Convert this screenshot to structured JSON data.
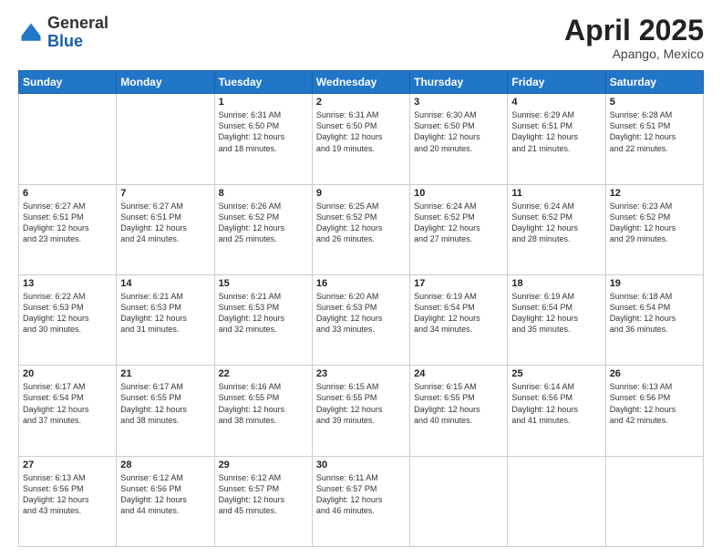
{
  "header": {
    "logo_general": "General",
    "logo_blue": "Blue",
    "month_title": "April 2025",
    "location": "Apango, Mexico"
  },
  "weekdays": [
    "Sunday",
    "Monday",
    "Tuesday",
    "Wednesday",
    "Thursday",
    "Friday",
    "Saturday"
  ],
  "weeks": [
    [
      {
        "day": "",
        "sunrise": "",
        "sunset": "",
        "daylight": ""
      },
      {
        "day": "",
        "sunrise": "",
        "sunset": "",
        "daylight": ""
      },
      {
        "day": "1",
        "sunrise": "Sunrise: 6:31 AM",
        "sunset": "Sunset: 6:50 PM",
        "daylight": "Daylight: 12 hours and 18 minutes."
      },
      {
        "day": "2",
        "sunrise": "Sunrise: 6:31 AM",
        "sunset": "Sunset: 6:50 PM",
        "daylight": "Daylight: 12 hours and 19 minutes."
      },
      {
        "day": "3",
        "sunrise": "Sunrise: 6:30 AM",
        "sunset": "Sunset: 6:50 PM",
        "daylight": "Daylight: 12 hours and 20 minutes."
      },
      {
        "day": "4",
        "sunrise": "Sunrise: 6:29 AM",
        "sunset": "Sunset: 6:51 PM",
        "daylight": "Daylight: 12 hours and 21 minutes."
      },
      {
        "day": "5",
        "sunrise": "Sunrise: 6:28 AM",
        "sunset": "Sunset: 6:51 PM",
        "daylight": "Daylight: 12 hours and 22 minutes."
      }
    ],
    [
      {
        "day": "6",
        "sunrise": "Sunrise: 6:27 AM",
        "sunset": "Sunset: 6:51 PM",
        "daylight": "Daylight: 12 hours and 23 minutes."
      },
      {
        "day": "7",
        "sunrise": "Sunrise: 6:27 AM",
        "sunset": "Sunset: 6:51 PM",
        "daylight": "Daylight: 12 hours and 24 minutes."
      },
      {
        "day": "8",
        "sunrise": "Sunrise: 6:26 AM",
        "sunset": "Sunset: 6:52 PM",
        "daylight": "Daylight: 12 hours and 25 minutes."
      },
      {
        "day": "9",
        "sunrise": "Sunrise: 6:25 AM",
        "sunset": "Sunset: 6:52 PM",
        "daylight": "Daylight: 12 hours and 26 minutes."
      },
      {
        "day": "10",
        "sunrise": "Sunrise: 6:24 AM",
        "sunset": "Sunset: 6:52 PM",
        "daylight": "Daylight: 12 hours and 27 minutes."
      },
      {
        "day": "11",
        "sunrise": "Sunrise: 6:24 AM",
        "sunset": "Sunset: 6:52 PM",
        "daylight": "Daylight: 12 hours and 28 minutes."
      },
      {
        "day": "12",
        "sunrise": "Sunrise: 6:23 AM",
        "sunset": "Sunset: 6:52 PM",
        "daylight": "Daylight: 12 hours and 29 minutes."
      }
    ],
    [
      {
        "day": "13",
        "sunrise": "Sunrise: 6:22 AM",
        "sunset": "Sunset: 6:53 PM",
        "daylight": "Daylight: 12 hours and 30 minutes."
      },
      {
        "day": "14",
        "sunrise": "Sunrise: 6:21 AM",
        "sunset": "Sunset: 6:53 PM",
        "daylight": "Daylight: 12 hours and 31 minutes."
      },
      {
        "day": "15",
        "sunrise": "Sunrise: 6:21 AM",
        "sunset": "Sunset: 6:53 PM",
        "daylight": "Daylight: 12 hours and 32 minutes."
      },
      {
        "day": "16",
        "sunrise": "Sunrise: 6:20 AM",
        "sunset": "Sunset: 6:53 PM",
        "daylight": "Daylight: 12 hours and 33 minutes."
      },
      {
        "day": "17",
        "sunrise": "Sunrise: 6:19 AM",
        "sunset": "Sunset: 6:54 PM",
        "daylight": "Daylight: 12 hours and 34 minutes."
      },
      {
        "day": "18",
        "sunrise": "Sunrise: 6:19 AM",
        "sunset": "Sunset: 6:54 PM",
        "daylight": "Daylight: 12 hours and 35 minutes."
      },
      {
        "day": "19",
        "sunrise": "Sunrise: 6:18 AM",
        "sunset": "Sunset: 6:54 PM",
        "daylight": "Daylight: 12 hours and 36 minutes."
      }
    ],
    [
      {
        "day": "20",
        "sunrise": "Sunrise: 6:17 AM",
        "sunset": "Sunset: 6:54 PM",
        "daylight": "Daylight: 12 hours and 37 minutes."
      },
      {
        "day": "21",
        "sunrise": "Sunrise: 6:17 AM",
        "sunset": "Sunset: 6:55 PM",
        "daylight": "Daylight: 12 hours and 38 minutes."
      },
      {
        "day": "22",
        "sunrise": "Sunrise: 6:16 AM",
        "sunset": "Sunset: 6:55 PM",
        "daylight": "Daylight: 12 hours and 38 minutes."
      },
      {
        "day": "23",
        "sunrise": "Sunrise: 6:15 AM",
        "sunset": "Sunset: 6:55 PM",
        "daylight": "Daylight: 12 hours and 39 minutes."
      },
      {
        "day": "24",
        "sunrise": "Sunrise: 6:15 AM",
        "sunset": "Sunset: 6:55 PM",
        "daylight": "Daylight: 12 hours and 40 minutes."
      },
      {
        "day": "25",
        "sunrise": "Sunrise: 6:14 AM",
        "sunset": "Sunset: 6:56 PM",
        "daylight": "Daylight: 12 hours and 41 minutes."
      },
      {
        "day": "26",
        "sunrise": "Sunrise: 6:13 AM",
        "sunset": "Sunset: 6:56 PM",
        "daylight": "Daylight: 12 hours and 42 minutes."
      }
    ],
    [
      {
        "day": "27",
        "sunrise": "Sunrise: 6:13 AM",
        "sunset": "Sunset: 6:56 PM",
        "daylight": "Daylight: 12 hours and 43 minutes."
      },
      {
        "day": "28",
        "sunrise": "Sunrise: 6:12 AM",
        "sunset": "Sunset: 6:56 PM",
        "daylight": "Daylight: 12 hours and 44 minutes."
      },
      {
        "day": "29",
        "sunrise": "Sunrise: 6:12 AM",
        "sunset": "Sunset: 6:57 PM",
        "daylight": "Daylight: 12 hours and 45 minutes."
      },
      {
        "day": "30",
        "sunrise": "Sunrise: 6:11 AM",
        "sunset": "Sunset: 6:57 PM",
        "daylight": "Daylight: 12 hours and 46 minutes."
      },
      {
        "day": "",
        "sunrise": "",
        "sunset": "",
        "daylight": ""
      },
      {
        "day": "",
        "sunrise": "",
        "sunset": "",
        "daylight": ""
      },
      {
        "day": "",
        "sunrise": "",
        "sunset": "",
        "daylight": ""
      }
    ]
  ]
}
